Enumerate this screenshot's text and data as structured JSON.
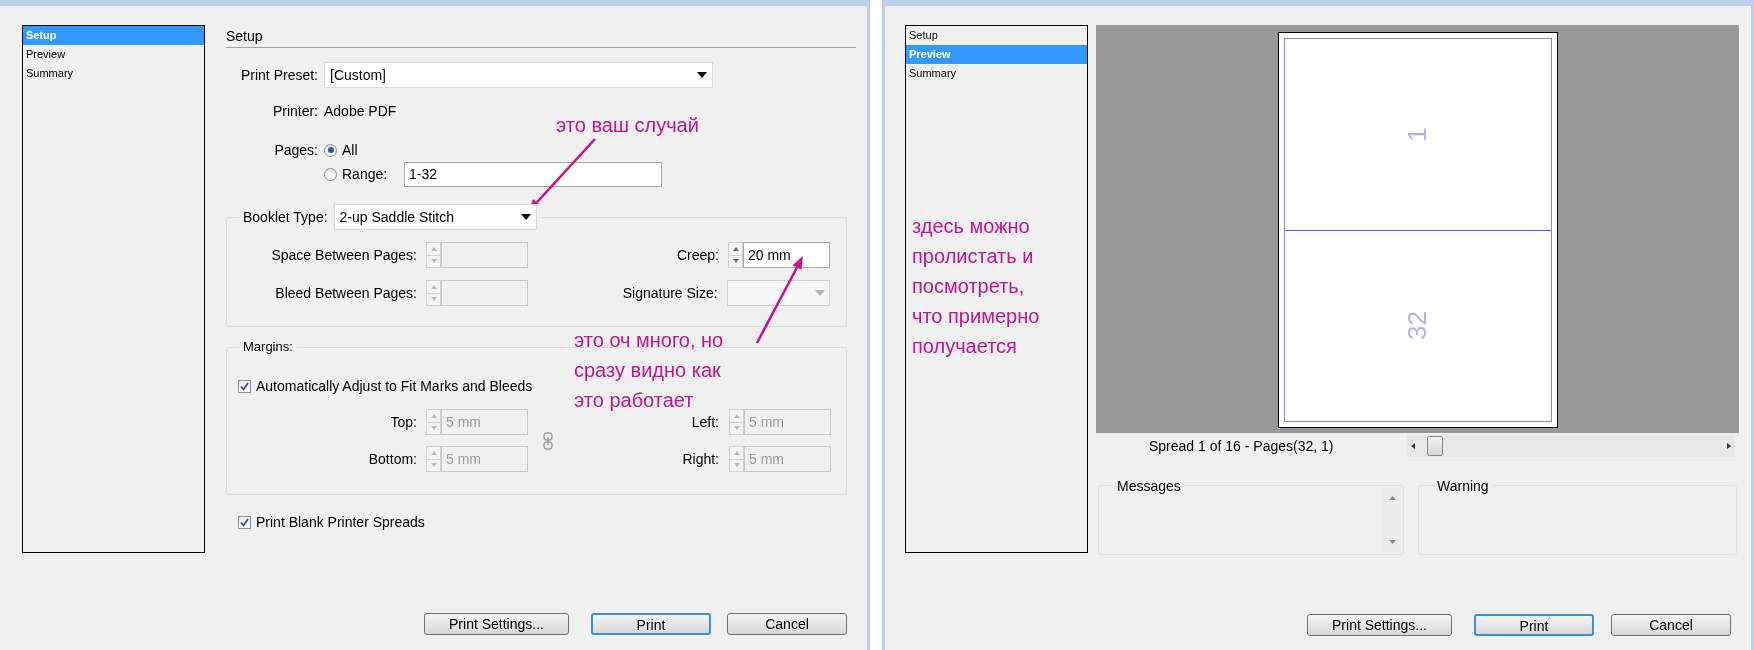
{
  "dialogs": [
    {
      "kind": "setup",
      "nav": [
        {
          "label": "Setup",
          "selected": true
        },
        {
          "label": "Preview",
          "selected": false
        },
        {
          "label": "Summary",
          "selected": false
        }
      ],
      "heading": "Setup",
      "print_preset": {
        "label": "Print Preset:",
        "value": "[Custom]"
      },
      "printer": {
        "label": "Printer:",
        "value": "Adobe PDF"
      },
      "pages": {
        "label": "Pages:",
        "options": [
          {
            "label": "All",
            "selected": true
          },
          {
            "label": "Range:",
            "selected": false
          }
        ],
        "range_value": "1-32"
      },
      "booklet": {
        "label": "Booklet Type:",
        "value": "2-up Saddle Stitch",
        "fields": [
          {
            "label": "Space Between Pages:",
            "kind": "spinner",
            "disabled": true
          },
          {
            "label": "Creep:",
            "kind": "spinner",
            "disabled": false,
            "value": "20 mm"
          },
          {
            "label": "Bleed Between Pages:",
            "kind": "spinner",
            "disabled": true
          },
          {
            "label": "Signature Size:",
            "kind": "dropdown",
            "disabled": true
          }
        ]
      },
      "margins": {
        "title": "Margins:",
        "auto_adjust": {
          "label": "Automatically Adjust to Fit Marks and Bleeds",
          "checked": true
        },
        "fields": [
          {
            "label": "Top:",
            "value": "5 mm",
            "disabled": true
          },
          {
            "label": "Left:",
            "value": "5 mm",
            "disabled": true
          },
          {
            "label": "Bottom:",
            "value": "5 mm",
            "disabled": true
          },
          {
            "label": "Right:",
            "value": "5 mm",
            "disabled": true
          }
        ]
      },
      "print_blank_spreads": {
        "label": "Print Blank Printer Spreads",
        "checked": true
      },
      "buttons": [
        {
          "label": "Print Settings...",
          "default": false
        },
        {
          "label": "Print",
          "default": true
        },
        {
          "label": "Cancel",
          "default": false
        }
      ],
      "annotations": [
        {
          "text": "это ваш случай"
        },
        {
          "text": "это оч много, но\nсразу видно как\nэто работает"
        }
      ]
    },
    {
      "kind": "preview",
      "nav": [
        {
          "label": "Setup",
          "selected": false
        },
        {
          "label": "Preview",
          "selected": true
        },
        {
          "label": "Summary",
          "selected": false
        }
      ],
      "preview": {
        "pages": [
          "1",
          "32"
        ],
        "spread_label": "Spread 1 of 16 - Pages(32, 1)"
      },
      "messages": {
        "title": "Messages"
      },
      "warning": {
        "title": "Warning"
      },
      "buttons": [
        {
          "label": "Print Settings...",
          "default": false
        },
        {
          "label": "Print",
          "default": true
        },
        {
          "label": "Cancel",
          "default": false
        }
      ],
      "annotations": [
        {
          "text": "здесь можно\nпролистать и\nпосмотреть,\nчто примерно\nполучается"
        }
      ]
    }
  ]
}
